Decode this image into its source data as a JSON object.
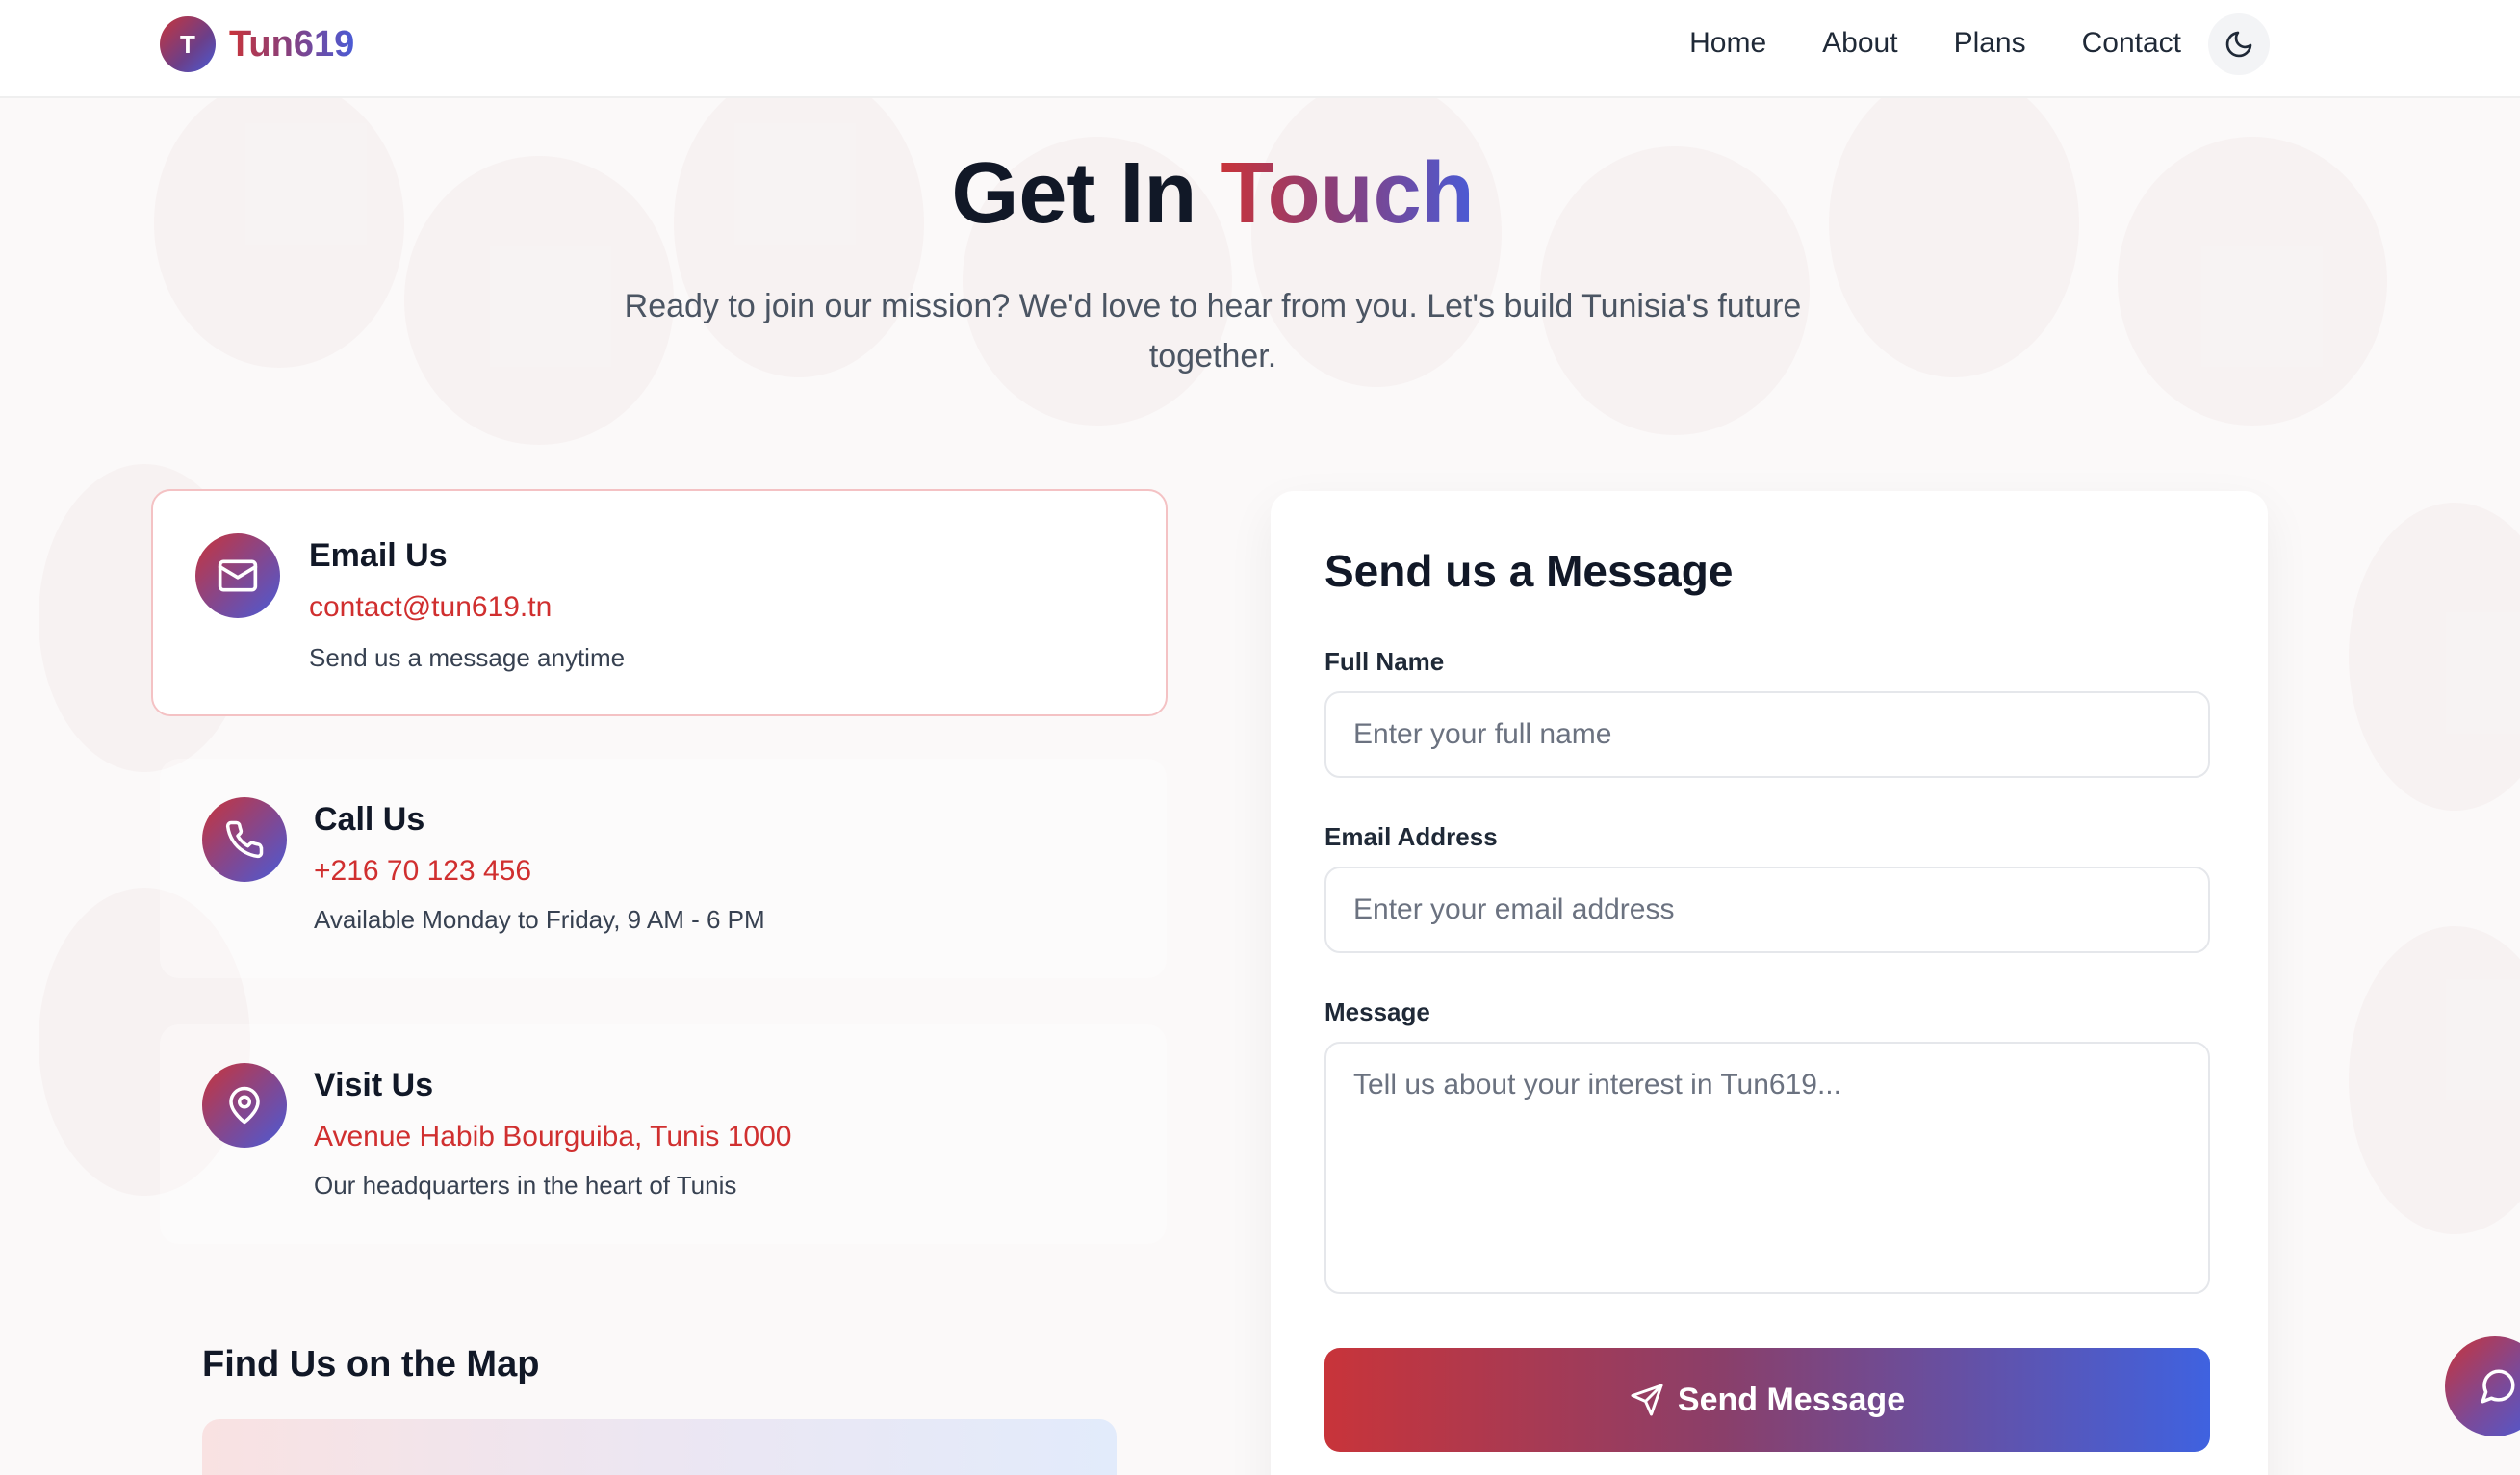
{
  "brand": {
    "badge": "T",
    "name": "Tun619"
  },
  "nav": [
    "Home",
    "About",
    "Plans",
    "Contact"
  ],
  "hero": {
    "title_plain": "Get In",
    "title_accent": "Touch",
    "subtitle": "Ready to join our mission? We'd love to hear from you. Let's build Tunisia's future together."
  },
  "contact_cards": [
    {
      "icon": "mail-icon",
      "title": "Email Us",
      "value": "contact@tun619.tn",
      "desc": "Send us a message anytime"
    },
    {
      "icon": "phone-icon",
      "title": "Call Us",
      "value": "+216 70 123 456",
      "desc": "Available Monday to Friday, 9 AM - 6 PM"
    },
    {
      "icon": "map-pin-icon",
      "title": "Visit Us",
      "value": "Avenue Habib Bourguiba, Tunis 1000",
      "desc": "Our headquarters in the heart of Tunis"
    }
  ],
  "map": {
    "title": "Find Us on the Map"
  },
  "form": {
    "title": "Send us a Message",
    "name_label": "Full Name",
    "name_placeholder": "Enter your full name",
    "email_label": "Email Address",
    "email_placeholder": "Enter your email address",
    "message_label": "Message",
    "message_placeholder": "Tell us about your interest in Tun619...",
    "submit_label": "Send Message"
  },
  "colors": {
    "brand_red": "#c8343a",
    "brand_blue": "#4a5bd6",
    "link_red": "#d02f2f"
  }
}
